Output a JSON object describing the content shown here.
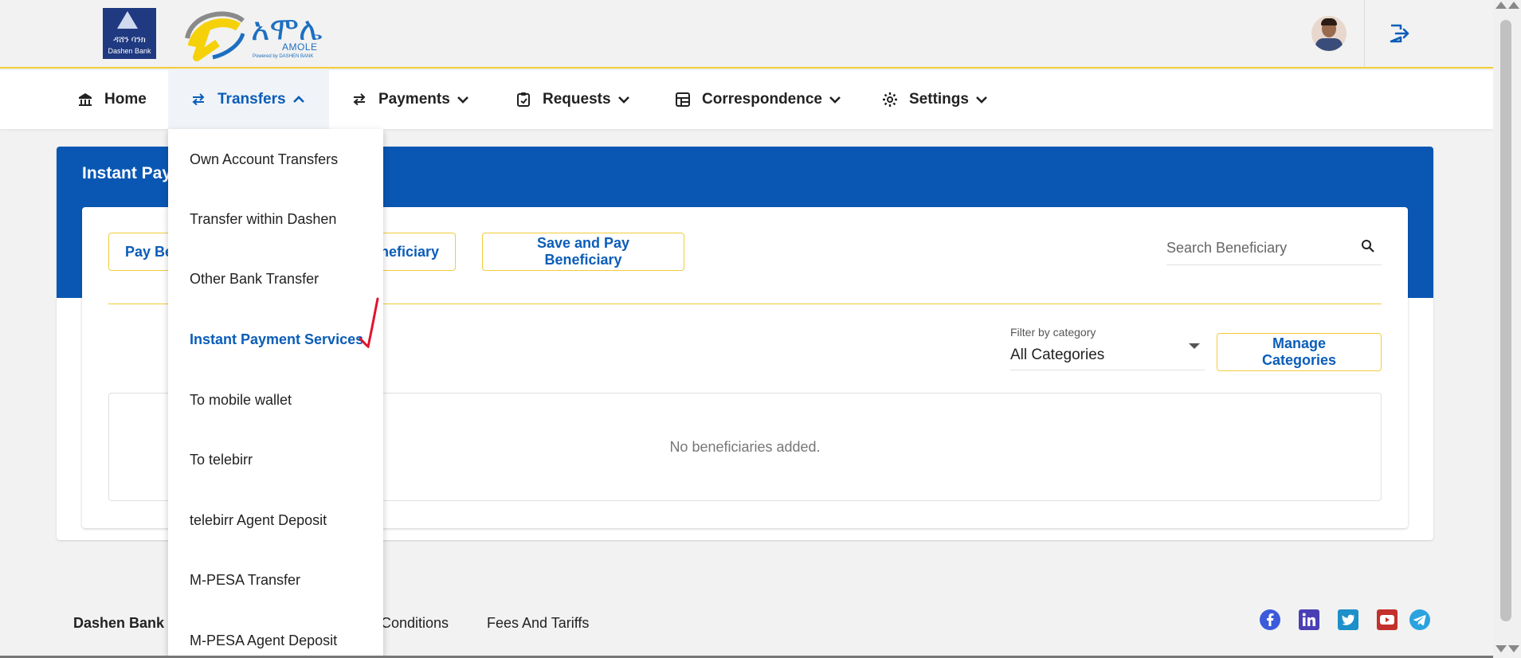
{
  "header": {
    "bank_logo_amh": "ዳሸን ባንክ",
    "bank_logo_en": "Dashen Bank",
    "amole_name_amh": "አሞሌ",
    "amole_name_en": "AMOLE",
    "amole_powered": "Powered by DASHEN BANK",
    "icons": {
      "avatar": "user-avatar",
      "logout": "logout-icon"
    }
  },
  "nav": {
    "items": [
      {
        "label": "Home",
        "icon": "bank-icon"
      },
      {
        "label": "Transfers",
        "icon": "transfer-arrows-icon",
        "expanded": true
      },
      {
        "label": "Payments",
        "icon": "transfer-arrows-icon"
      },
      {
        "label": "Requests",
        "icon": "clipboard-icon"
      },
      {
        "label": "Correspondence",
        "icon": "dashboard-icon"
      },
      {
        "label": "Settings",
        "icon": "gear-icon"
      }
    ]
  },
  "transfers_menu": {
    "items": [
      "Own Account Transfers",
      "Transfer within Dashen",
      "Other Bank Transfer",
      "Instant Payment Services",
      "To mobile wallet",
      "To telebirr",
      "telebirr Agent Deposit",
      "M-PESA Transfer",
      "M-PESA Agent Deposit"
    ],
    "selected": "Instant Payment Services"
  },
  "main": {
    "title_visible": "Instant Pay",
    "buttons": {
      "pay_beneficiary_visible": "Pay Be",
      "add_beneficiary_visible": "neficiary",
      "save_and_pay": "Save and Pay Beneficiary",
      "manage_categories": "Manage Categories"
    },
    "search": {
      "placeholder": "Search Beneficiary"
    },
    "filter": {
      "label": "Filter by category",
      "value": "All Categories"
    },
    "empty_message": "No beneficiaries added."
  },
  "footer": {
    "bank_name": "Dashen Bank",
    "conditions_visible": "Conditions",
    "fees": "Fees And Tariffs",
    "social": [
      "facebook-icon",
      "linkedin-icon",
      "twitter-icon",
      "youtube-icon",
      "telegram-icon"
    ]
  },
  "colors": {
    "primary_blue": "#0957b3",
    "link_blue": "#0b5db8",
    "accent_yellow": "#f2cc3a",
    "annotation_red": "#e0142b"
  }
}
